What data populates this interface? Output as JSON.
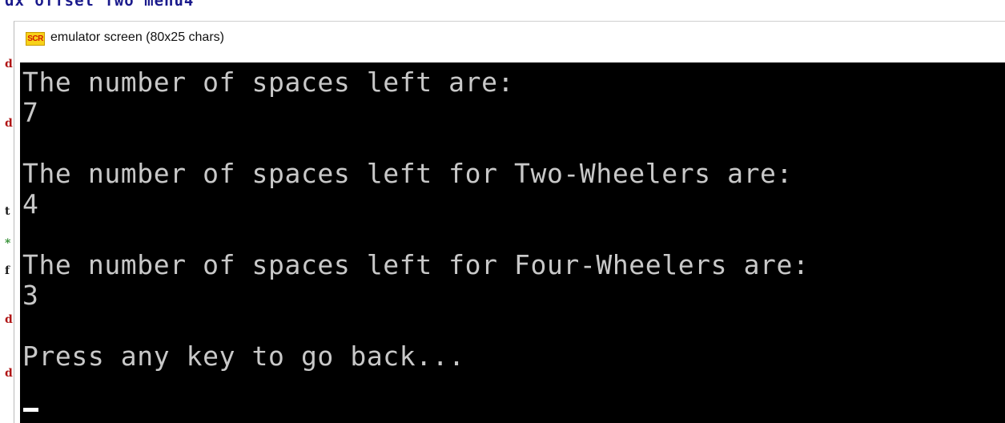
{
  "background_editor": {
    "top_line": "dx offset Two menu4",
    "gutter_chars": [
      "d",
      "d",
      "t",
      "*",
      "f",
      "d",
      "d"
    ]
  },
  "window": {
    "title": "emulator screen (80x25 chars)",
    "icon_text": "SCR",
    "icon_name": "emulator-app-icon"
  },
  "screen": {
    "lines": [
      "The number of spaces left are:",
      "7",
      "",
      "The number of spaces left for Two-Wheelers are:",
      "4",
      "",
      "The number of spaces left for Four-Wheelers are:",
      "3",
      "",
      "Press any key to go back..."
    ],
    "colors": {
      "background": "#000000",
      "text": "#c8c8c8",
      "cursor": "#ffffff"
    }
  }
}
